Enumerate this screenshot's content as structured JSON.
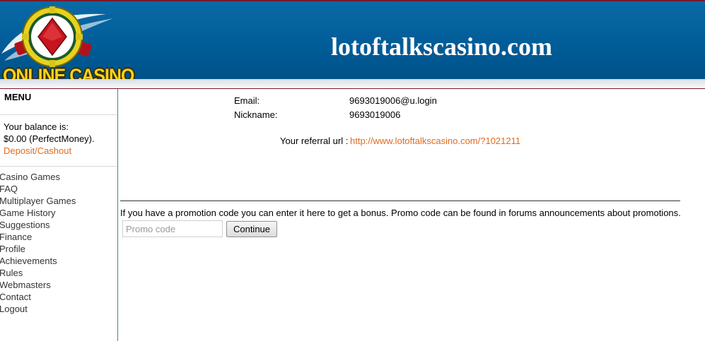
{
  "header": {
    "site_title": "lotoftalkscasino.com",
    "logo_text": "ONLINE CASINO",
    "colors": {
      "header_blue": "#005b96",
      "accent_red": "#7a1a2a"
    }
  },
  "sidebar": {
    "menu_title": "MENU",
    "balance_label": "Your balance is:",
    "balance_value": "$0.00 (PerfectMoney).",
    "deposit_link": "Deposit/Cashout",
    "items": [
      {
        "label": "Casino Games"
      },
      {
        "label": "FAQ"
      },
      {
        "label": "Multiplayer Games"
      },
      {
        "label": "Game History"
      },
      {
        "label": "Suggestions"
      },
      {
        "label": "Finance"
      },
      {
        "label": "Profile"
      },
      {
        "label": "Achievements"
      },
      {
        "label": "Rules"
      },
      {
        "label": "Webmasters"
      },
      {
        "label": "Contact"
      },
      {
        "label": "Logout"
      }
    ]
  },
  "account": {
    "email_label": "Email:",
    "email_value": "9693019006@u.login",
    "nickname_label": "Nickname:",
    "nickname_value": "9693019006",
    "referral_label": "Your referral url :",
    "referral_url": "http://www.lotoftalkscasino.com/?1021211"
  },
  "promo": {
    "text": "If you have a promotion code you can enter it here to get a bonus. Promo code can be found in forums announcements about promotions.",
    "input_placeholder": "Promo code",
    "input_value": "",
    "button_label": "Continue"
  }
}
